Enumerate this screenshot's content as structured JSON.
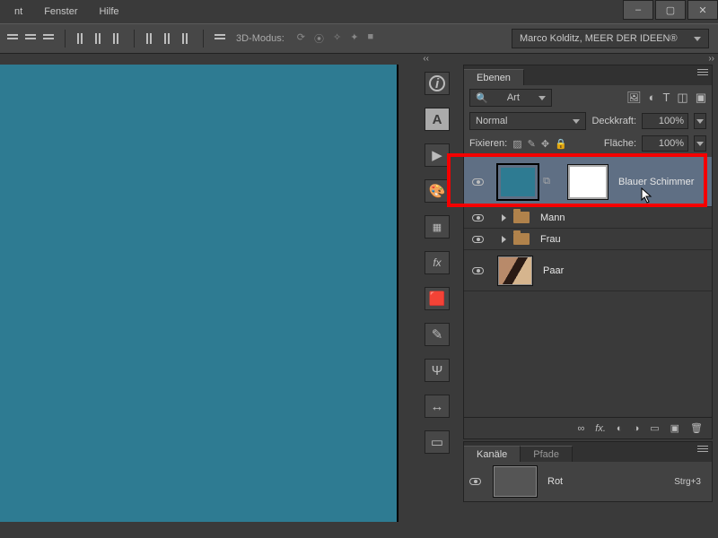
{
  "menu": {
    "nt": "nt",
    "fenster": "Fenster",
    "hilfe": "Hilfe"
  },
  "opt": {
    "mode_label": "3D-Modus:",
    "doc_title": "Marco Kolditz, MEER DER IDEEN®"
  },
  "layers_panel": {
    "tab": "Ebenen",
    "pfind_label": "Art",
    "blend": "Normal",
    "deckkraft_label": "Deckkraft:",
    "deckkraft_value": "100%",
    "fixieren_label": "Fixieren:",
    "flaeche_label": "Fläche:",
    "flaeche_value": "100%",
    "layers": [
      {
        "name": "Blauer Schimmer",
        "kind": "adj-with-mask",
        "selected": true
      },
      {
        "name": "Mann",
        "kind": "group"
      },
      {
        "name": "Frau",
        "kind": "group"
      },
      {
        "name": "Paar",
        "kind": "image"
      }
    ],
    "footer_icons": [
      "∞",
      "fx.",
      "◐",
      "◑",
      "▣",
      "🗑"
    ]
  },
  "channels_panel": {
    "tab_channels": "Kanäle",
    "tab_paths": "Pfade",
    "rows": [
      {
        "name": "Rot",
        "shortcut": "Strg+3"
      }
    ]
  },
  "minidock": {
    "items": [
      "info",
      "A",
      "play",
      "swatches",
      "grid",
      "fx",
      "color",
      "pipette",
      "trident",
      "measure",
      "slice"
    ]
  }
}
